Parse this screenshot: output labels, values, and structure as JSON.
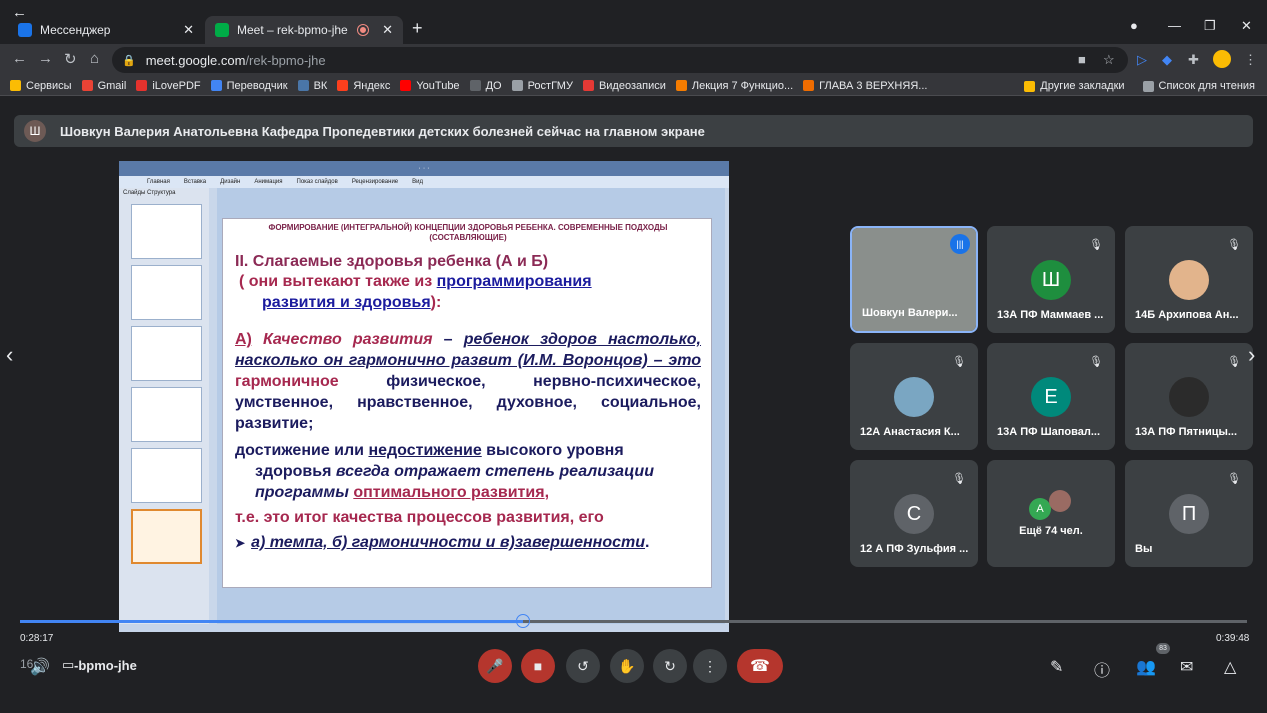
{
  "browser": {
    "tabs": [
      {
        "title": "Мессенджер",
        "favicon_color": "#1a73e8"
      },
      {
        "title": "Meet – rek-bpmo-jhe",
        "favicon_color": "#00ac47"
      }
    ],
    "url_host": "meet.google.com",
    "url_path": "/rek-bpmo-jhe",
    "bookmarks": [
      {
        "label": "Сервисы",
        "color": "#fbbc04"
      },
      {
        "label": "Gmail",
        "color": "#ea4335"
      },
      {
        "label": "iLovePDF",
        "color": "#e5322d"
      },
      {
        "label": "Переводчик",
        "color": "#4285f4"
      },
      {
        "label": "ВК",
        "color": "#4a76a8"
      },
      {
        "label": "Яндекс",
        "color": "#fc3f1d"
      },
      {
        "label": "YouTube",
        "color": "#ff0000"
      },
      {
        "label": "ДО",
        "color": "#5f6368"
      },
      {
        "label": "РостГМУ",
        "color": "#9aa0a6"
      },
      {
        "label": "Видеозаписи",
        "color": "#e53935"
      },
      {
        "label": "Лекция 7 Функцио...",
        "color": "#f57c00"
      },
      {
        "label": "ГЛАВА 3 ВЕРХНЯЯ...",
        "color": "#ef6c00"
      }
    ],
    "bookmarks_other": "Другие закладки",
    "reading_list": "Список для чтения"
  },
  "meet": {
    "banner_avatar_letter": "Ш",
    "banner_text": "Шовкун Валерия Анатольевна Кафедра Пропедевтики детских болезней сейчас на главном экране",
    "slide": {
      "header": "ФОРМИРОВАНИЕ (ИНТЕГРАЛЬНОЙ) КОНЦЕПЦИИ ЗДОРОВЬЯ РЕБЕНКА. СОВРЕМЕННЫЕ ПОДХОДЫ (СОСТАВЛЯЮЩИЕ)",
      "line1": "II. Слагаемые здоровья ребенка (А и Б)",
      "line2a": "( они вытекают также из ",
      "line2b": "программирования",
      "line3a": "развития и здоровья",
      "line3b": "):",
      "p1_a": "А)",
      "p1_b": " Качество развития",
      "p1_c": " – ",
      "p1_d": "ребенок здоров настолько, насколько он гармонично развит (И.М. Воронцов) – это ",
      "p1_e": "гармоничное",
      "p1_f": " физическое, нервно-психическое, умственное, нравственное, духовное, социальное, развитие;",
      "p2_a": "достижение или ",
      "p2_b": "недостижение",
      "p2_c": " высокого уровня",
      "p2_d": "здоровья ",
      "p2_e": "всегда отражает степень реализации программы ",
      "p2_f": "оптимального развития",
      "p2_g": ",",
      "p3": "т.е. это итог качества процессов развития, его",
      "p4": "а) темпа, б) гармоничности и в)завершенности",
      "p4_end": "."
    },
    "ppt_ribbon": [
      "Главная",
      "Вставка",
      "Дизайн",
      "Анимация",
      "Показ слайдов",
      "Рецензирование",
      "Вид"
    ],
    "ppt_tabs": "Слайды  Структура",
    "participants": [
      {
        "name": "Шовкун Валери...",
        "type": "photo",
        "color": "#8a8f8c",
        "speaking": true
      },
      {
        "name": "13А ПФ Маммаев ...",
        "type": "letter",
        "letter": "Ш",
        "color": "#1e8e3e"
      },
      {
        "name": "14Б Архипова Ан...",
        "type": "photo",
        "color": "#e2b48c"
      },
      {
        "name": "12А Анастасия К...",
        "type": "photo",
        "color": "#7aa6c2"
      },
      {
        "name": "13А ПФ Шаповал...",
        "type": "letter",
        "letter": "Е",
        "color": "#00897b"
      },
      {
        "name": "13А ПФ Пятницы...",
        "type": "photo",
        "color": "#2b2b2b"
      },
      {
        "name": "12 А ПФ Зульфия ...",
        "type": "letter",
        "letter": "С",
        "color": "#5f6368"
      },
      {
        "name": "Ещё 74 чел.",
        "type": "more",
        "letter": "А",
        "color": "#34a853"
      },
      {
        "name": "Вы",
        "type": "letter",
        "letter": "П",
        "color": "#5f6368"
      }
    ],
    "meeting_code": "-bpmo-jhe",
    "meeting_code_prefix": "16:",
    "time_elapsed": "0:28:17",
    "time_total": "0:39:48",
    "progress_fraction": 0.41,
    "participants_count": "83"
  }
}
